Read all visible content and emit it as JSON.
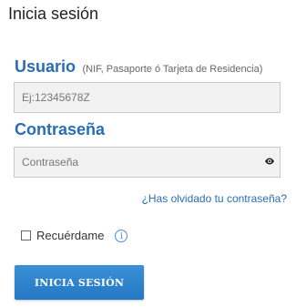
{
  "login": {
    "title": "Inicia sesión",
    "user_label": "Usuario",
    "user_hint": "(NIF, Pasaporte ó Tarjeta de Residencia)",
    "user_placeholder": "Ej:12345678Z",
    "password_label": "Contraseña",
    "password_placeholder": "Contraseña",
    "forgot_link": "¿Has olvidado tu contraseña?",
    "remember_label": "Recuérdame",
    "info_glyph": "i",
    "submit_label": "INICIA SESIÓN"
  },
  "icons": {
    "password_toggle": "eye-icon",
    "remember_info": "info-icon"
  },
  "colors": {
    "accent": "#2a6db4",
    "button": "#2e86cf",
    "input_bg": "#f2f2f2"
  }
}
